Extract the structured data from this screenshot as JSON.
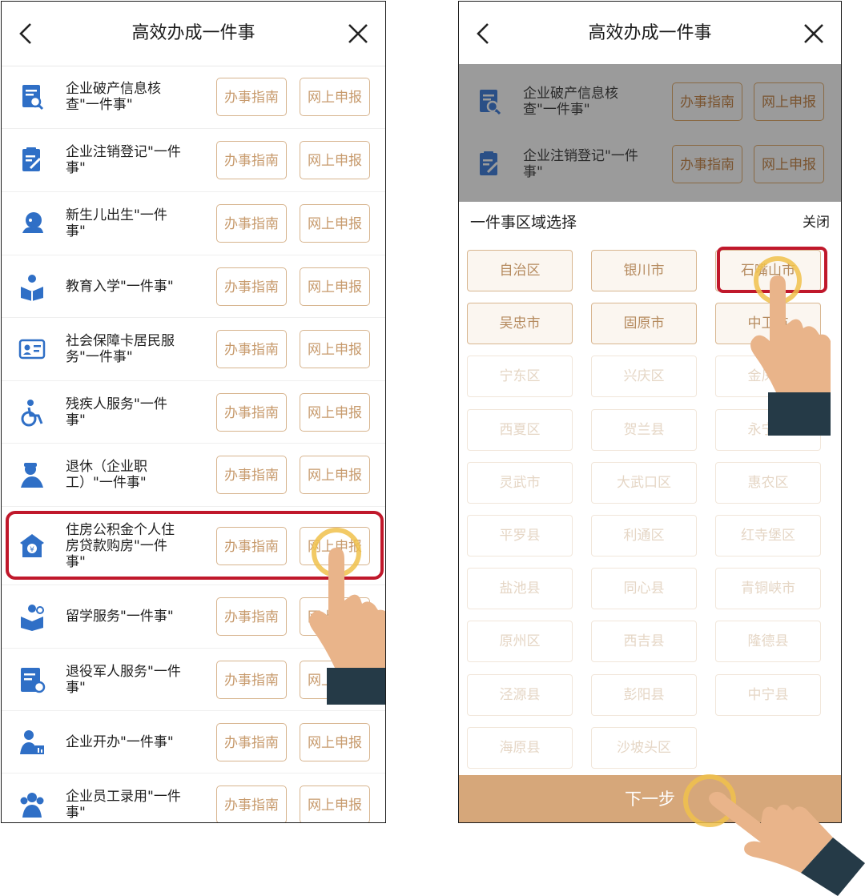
{
  "left": {
    "title": "高效办成一件事",
    "services": [
      {
        "name": "企业破产信息核\n查\"一件事\"",
        "icon": "document-search-icon",
        "guide": "办事指南",
        "apply": "网上申报"
      },
      {
        "name": "企业注销登记\"一件\n事\"",
        "icon": "clipboard-edit-icon",
        "guide": "办事指南",
        "apply": "网上申报"
      },
      {
        "name": "新生儿出生\"一件\n事\"",
        "icon": "baby-icon",
        "guide": "办事指南",
        "apply": "网上申报"
      },
      {
        "name": "教育入学\"一件事\"",
        "icon": "reading-child-icon",
        "guide": "办事指南",
        "apply": "网上申报"
      },
      {
        "name": "社会保障卡居民服\n务\"一件事\"",
        "icon": "id-card-icon",
        "guide": "办事指南",
        "apply": "网上申报"
      },
      {
        "name": "残疾人服务\"一件\n事\"",
        "icon": "wheelchair-icon",
        "guide": "办事指南",
        "apply": "网上申报"
      },
      {
        "name": "退休（企业职\n工）\"一件事\"",
        "icon": "retiree-icon",
        "guide": "办事指南",
        "apply": "网上申报"
      },
      {
        "name": "住房公积金个人住\n房贷款购房\"一件\n事\"",
        "icon": "house-fund-icon",
        "guide": "办事指南",
        "apply": "网上申报"
      },
      {
        "name": "留学服务\"一件事\"",
        "icon": "study-abroad-icon",
        "guide": "办事指南",
        "apply": "网上申报"
      },
      {
        "name": "退役军人服务\"一件\n事\"",
        "icon": "veteran-doc-icon",
        "guide": "办事指南",
        "apply": "网上申报"
      },
      {
        "name": "企业开办\"一件事\"",
        "icon": "business-person-icon",
        "guide": "办事指南",
        "apply": "网上申报"
      },
      {
        "name": "企业员工录用\"一件\n事\"",
        "icon": "employees-icon",
        "guide": "办事指南",
        "apply": "网上申报"
      }
    ]
  },
  "right": {
    "title": "高效办成一件事",
    "dimmed_services": [
      {
        "name": "企业破产信息核\n查\"一件事\"",
        "guide": "办事指南",
        "apply": "网上申报"
      },
      {
        "name": "企业注销登记\"一件\n事\"",
        "guide": "办事指南",
        "apply": "网上申报"
      }
    ],
    "sheet_title": "一件事区域选择",
    "sheet_close": "关闭",
    "regions": [
      {
        "label": "自治区",
        "enabled": true
      },
      {
        "label": "银川市",
        "enabled": true
      },
      {
        "label": "石嘴山市",
        "enabled": true,
        "selected": true
      },
      {
        "label": "吴忠市",
        "enabled": true
      },
      {
        "label": "固原市",
        "enabled": true
      },
      {
        "label": "中卫市",
        "enabled": true
      },
      {
        "label": "宁东区",
        "enabled": false
      },
      {
        "label": "兴庆区",
        "enabled": false
      },
      {
        "label": "金凤区",
        "enabled": false
      },
      {
        "label": "西夏区",
        "enabled": false
      },
      {
        "label": "贺兰县",
        "enabled": false
      },
      {
        "label": "永宁县",
        "enabled": false
      },
      {
        "label": "灵武市",
        "enabled": false
      },
      {
        "label": "大武口区",
        "enabled": false
      },
      {
        "label": "惠农区",
        "enabled": false
      },
      {
        "label": "平罗县",
        "enabled": false
      },
      {
        "label": "利通区",
        "enabled": false
      },
      {
        "label": "红寺堡区",
        "enabled": false
      },
      {
        "label": "盐池县",
        "enabled": false
      },
      {
        "label": "同心县",
        "enabled": false
      },
      {
        "label": "青铜峡市",
        "enabled": false
      },
      {
        "label": "原州区",
        "enabled": false
      },
      {
        "label": "西吉县",
        "enabled": false
      },
      {
        "label": "隆德县",
        "enabled": false
      },
      {
        "label": "泾源县",
        "enabled": false
      },
      {
        "label": "彭阳县",
        "enabled": false
      },
      {
        "label": "中宁县",
        "enabled": false
      },
      {
        "label": "海原县",
        "enabled": false
      },
      {
        "label": "沙坡头区",
        "enabled": false
      }
    ],
    "next_button": "下一步"
  },
  "colors": {
    "accent": "#d6a77a",
    "button_text": "#c79a6c",
    "highlight": "#c0182b",
    "icon_blue": "#2f6fc6",
    "hand_skin": "#e9b48a",
    "sleeve": "#253a47",
    "tap_ring": "#f0c14b"
  }
}
